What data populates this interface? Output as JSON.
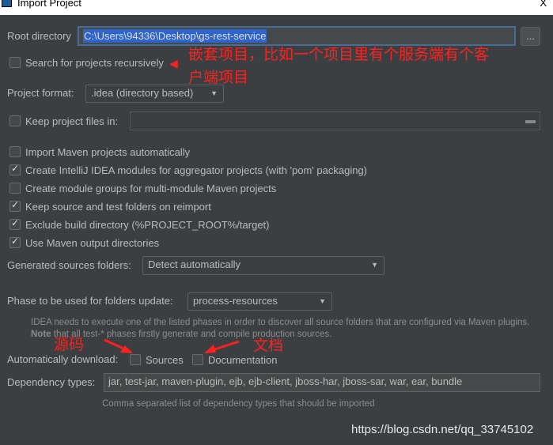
{
  "window": {
    "title": "Import Project",
    "close": "X"
  },
  "root": {
    "label": "Root directory",
    "value": "C:\\Users\\94336\\Desktop\\gs-rest-service",
    "browse": "..."
  },
  "search_recursive": {
    "label": "Search for projects recursively",
    "checked": false
  },
  "project_format": {
    "label": "Project format:",
    "value": ".idea (directory based)"
  },
  "keep_files": {
    "label": "Keep project files in:",
    "value": "",
    "checked": false
  },
  "options": [
    {
      "label": "Import Maven projects automatically",
      "checked": false
    },
    {
      "label": "Create IntelliJ IDEA modules for aggregator projects (with 'pom' packaging)",
      "checked": true
    },
    {
      "label": "Create module groups for multi-module Maven projects",
      "checked": false
    },
    {
      "label": "Keep source and test folders on reimport",
      "checked": true
    },
    {
      "label": "Exclude build directory (%PROJECT_ROOT%/target)",
      "checked": true
    },
    {
      "label": "Use Maven output directories",
      "checked": true
    }
  ],
  "generated_sources": {
    "label": "Generated sources folders:",
    "value": "Detect automatically"
  },
  "phase": {
    "label": "Phase to be used for folders update:",
    "value": "process-resources",
    "hint1": "IDEA needs to execute one of the listed phases in order to discover all source folders that are configured via Maven plugins.",
    "hint2_bold": "Note",
    "hint2": " that all test-* phases firstly generate and compile production sources."
  },
  "auto_download": {
    "label": "Automatically download:",
    "sources": "Sources",
    "documentation": "Documentation",
    "sources_checked": false,
    "documentation_checked": false
  },
  "dependency_types": {
    "label": "Dependency types:",
    "value": "jar, test-jar, maven-plugin, ejb, ejb-client, jboss-har, jboss-sar, war, ear, bundle",
    "hint": "Comma separated list of dependency types that should be imported"
  },
  "annotations": {
    "nested_line1": "嵌套项目，比如一个项目里有个服务端有个客",
    "nested_line2": "户端项目",
    "sources": "源码",
    "docs": "文档",
    "color": "#ff2020"
  },
  "watermark": "https://blog.csdn.net/qq_33745102"
}
